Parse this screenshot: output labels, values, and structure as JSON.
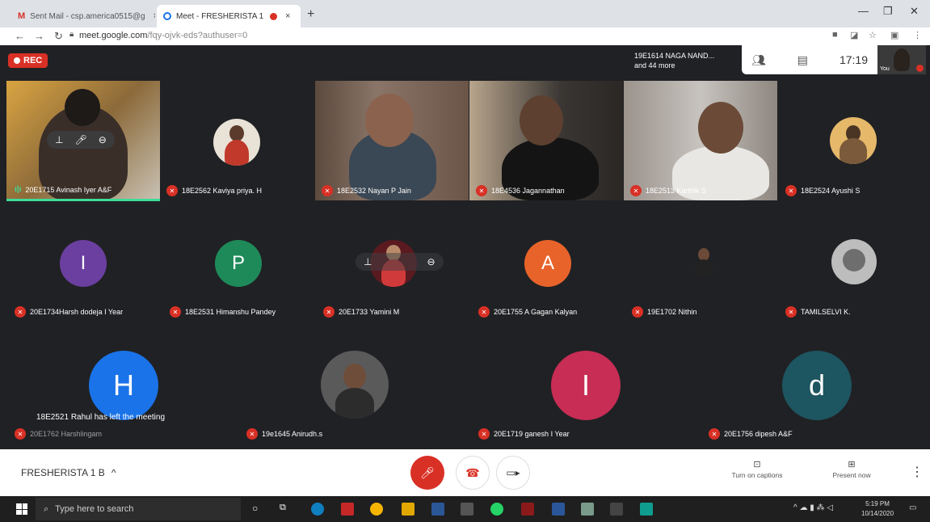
{
  "browser": {
    "tabs": [
      {
        "label": "Sent Mail - csp.america0515@g",
        "icon": "gmail-icon"
      },
      {
        "label": "Meet - FRESHERISTA 1 B",
        "icon": "meet-icon"
      }
    ],
    "url_host": "meet.google.com",
    "url_path": "/fqy-ojvk-eds?authuser=0"
  },
  "meet": {
    "rec_label": "REC",
    "top_info_line1": "19E1614 NAGA NAND...",
    "top_info_line2": "and 44 more",
    "clock": "17:19",
    "self_label": "You",
    "toast": "18E2521 Rahul has left the meeting",
    "participants_row1": [
      {
        "name": "20E1715 Avinash Iyer A&F",
        "muted": false
      },
      {
        "name": "18E2562 Kaviya priya. H",
        "muted": true
      },
      {
        "name": "18E2532 Nayan P Jain",
        "muted": true
      },
      {
        "name": "18E4536 Jagannathan",
        "muted": true
      },
      {
        "name": "18E2513 Karthik S",
        "muted": true
      },
      {
        "name": "18E2524 Ayushi S",
        "muted": true
      }
    ],
    "participants_row2": [
      {
        "name": "20E1734Harsh dodeja I Year",
        "initial": "I",
        "color": "#6a3fa0"
      },
      {
        "name": "18E2531 Himanshu Pandey",
        "initial": "P",
        "color": "#1e8a5a"
      },
      {
        "name": "20E1733 Yamini M",
        "initial": "",
        "color": ""
      },
      {
        "name": "20E1755 A Gagan Kalyan",
        "initial": "A",
        "color": "#e8632a"
      },
      {
        "name": "19E1702 Nithin",
        "initial": "",
        "color": ""
      },
      {
        "name": "TAMILSELVI K.",
        "initial": "",
        "color": ""
      }
    ],
    "participants_row3": [
      {
        "name": "20E1762 Harshlingam",
        "initial": "H",
        "color": "#1a73e8"
      },
      {
        "name": "19e1645 Anirudh.s",
        "initial": "",
        "color": ""
      },
      {
        "name": "20E1719 ganesh I Year",
        "initial": "I",
        "color": "#c72d55"
      },
      {
        "name": "20E1756 dipesh A&F",
        "initial": "d",
        "color": "#1d5560"
      }
    ]
  },
  "bottom": {
    "meeting_name": "FRESHERISTA 1 B",
    "captions_label": "Turn on captions",
    "present_label": "Present now"
  },
  "taskbar": {
    "search_placeholder": "Type here to search",
    "time": "5:19 PM",
    "date": "10/14/2020"
  }
}
